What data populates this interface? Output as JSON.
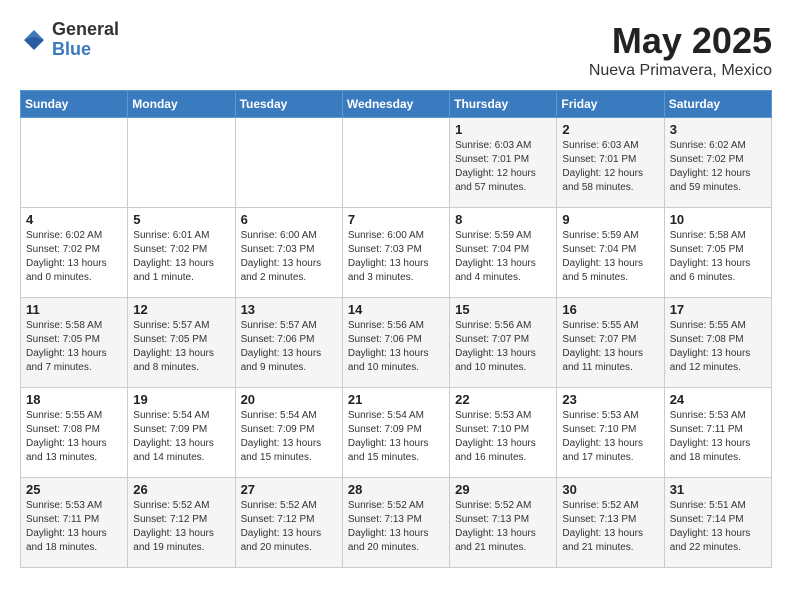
{
  "logo": {
    "general": "General",
    "blue": "Blue"
  },
  "title": "May 2025",
  "location": "Nueva Primavera, Mexico",
  "days_of_week": [
    "Sunday",
    "Monday",
    "Tuesday",
    "Wednesday",
    "Thursday",
    "Friday",
    "Saturday"
  ],
  "weeks": [
    [
      {
        "day": "",
        "info": ""
      },
      {
        "day": "",
        "info": ""
      },
      {
        "day": "",
        "info": ""
      },
      {
        "day": "",
        "info": ""
      },
      {
        "day": "1",
        "info": "Sunrise: 6:03 AM\nSunset: 7:01 PM\nDaylight: 12 hours\nand 57 minutes."
      },
      {
        "day": "2",
        "info": "Sunrise: 6:03 AM\nSunset: 7:01 PM\nDaylight: 12 hours\nand 58 minutes."
      },
      {
        "day": "3",
        "info": "Sunrise: 6:02 AM\nSunset: 7:02 PM\nDaylight: 12 hours\nand 59 minutes."
      }
    ],
    [
      {
        "day": "4",
        "info": "Sunrise: 6:02 AM\nSunset: 7:02 PM\nDaylight: 13 hours\nand 0 minutes."
      },
      {
        "day": "5",
        "info": "Sunrise: 6:01 AM\nSunset: 7:02 PM\nDaylight: 13 hours\nand 1 minute."
      },
      {
        "day": "6",
        "info": "Sunrise: 6:00 AM\nSunset: 7:03 PM\nDaylight: 13 hours\nand 2 minutes."
      },
      {
        "day": "7",
        "info": "Sunrise: 6:00 AM\nSunset: 7:03 PM\nDaylight: 13 hours\nand 3 minutes."
      },
      {
        "day": "8",
        "info": "Sunrise: 5:59 AM\nSunset: 7:04 PM\nDaylight: 13 hours\nand 4 minutes."
      },
      {
        "day": "9",
        "info": "Sunrise: 5:59 AM\nSunset: 7:04 PM\nDaylight: 13 hours\nand 5 minutes."
      },
      {
        "day": "10",
        "info": "Sunrise: 5:58 AM\nSunset: 7:05 PM\nDaylight: 13 hours\nand 6 minutes."
      }
    ],
    [
      {
        "day": "11",
        "info": "Sunrise: 5:58 AM\nSunset: 7:05 PM\nDaylight: 13 hours\nand 7 minutes."
      },
      {
        "day": "12",
        "info": "Sunrise: 5:57 AM\nSunset: 7:05 PM\nDaylight: 13 hours\nand 8 minutes."
      },
      {
        "day": "13",
        "info": "Sunrise: 5:57 AM\nSunset: 7:06 PM\nDaylight: 13 hours\nand 9 minutes."
      },
      {
        "day": "14",
        "info": "Sunrise: 5:56 AM\nSunset: 7:06 PM\nDaylight: 13 hours\nand 10 minutes."
      },
      {
        "day": "15",
        "info": "Sunrise: 5:56 AM\nSunset: 7:07 PM\nDaylight: 13 hours\nand 10 minutes."
      },
      {
        "day": "16",
        "info": "Sunrise: 5:55 AM\nSunset: 7:07 PM\nDaylight: 13 hours\nand 11 minutes."
      },
      {
        "day": "17",
        "info": "Sunrise: 5:55 AM\nSunset: 7:08 PM\nDaylight: 13 hours\nand 12 minutes."
      }
    ],
    [
      {
        "day": "18",
        "info": "Sunrise: 5:55 AM\nSunset: 7:08 PM\nDaylight: 13 hours\nand 13 minutes."
      },
      {
        "day": "19",
        "info": "Sunrise: 5:54 AM\nSunset: 7:09 PM\nDaylight: 13 hours\nand 14 minutes."
      },
      {
        "day": "20",
        "info": "Sunrise: 5:54 AM\nSunset: 7:09 PM\nDaylight: 13 hours\nand 15 minutes."
      },
      {
        "day": "21",
        "info": "Sunrise: 5:54 AM\nSunset: 7:09 PM\nDaylight: 13 hours\nand 15 minutes."
      },
      {
        "day": "22",
        "info": "Sunrise: 5:53 AM\nSunset: 7:10 PM\nDaylight: 13 hours\nand 16 minutes."
      },
      {
        "day": "23",
        "info": "Sunrise: 5:53 AM\nSunset: 7:10 PM\nDaylight: 13 hours\nand 17 minutes."
      },
      {
        "day": "24",
        "info": "Sunrise: 5:53 AM\nSunset: 7:11 PM\nDaylight: 13 hours\nand 18 minutes."
      }
    ],
    [
      {
        "day": "25",
        "info": "Sunrise: 5:53 AM\nSunset: 7:11 PM\nDaylight: 13 hours\nand 18 minutes."
      },
      {
        "day": "26",
        "info": "Sunrise: 5:52 AM\nSunset: 7:12 PM\nDaylight: 13 hours\nand 19 minutes."
      },
      {
        "day": "27",
        "info": "Sunrise: 5:52 AM\nSunset: 7:12 PM\nDaylight: 13 hours\nand 20 minutes."
      },
      {
        "day": "28",
        "info": "Sunrise: 5:52 AM\nSunset: 7:13 PM\nDaylight: 13 hours\nand 20 minutes."
      },
      {
        "day": "29",
        "info": "Sunrise: 5:52 AM\nSunset: 7:13 PM\nDaylight: 13 hours\nand 21 minutes."
      },
      {
        "day": "30",
        "info": "Sunrise: 5:52 AM\nSunset: 7:13 PM\nDaylight: 13 hours\nand 21 minutes."
      },
      {
        "day": "31",
        "info": "Sunrise: 5:51 AM\nSunset: 7:14 PM\nDaylight: 13 hours\nand 22 minutes."
      }
    ]
  ]
}
